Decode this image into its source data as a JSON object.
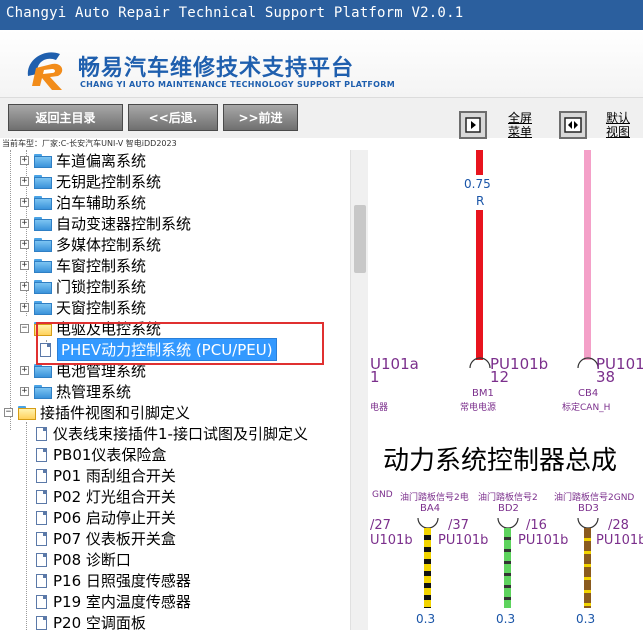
{
  "window": {
    "title": "Changyi Auto Repair Technical Support Platform V2.0.1"
  },
  "banner": {
    "brand_cn": "畅易汽车维修技术支持平台",
    "brand_en": "CHANG YI AUTO MAINTENANCE TECHNOLOGY SUPPORT PLATFORM"
  },
  "toolbar": {
    "home": "返回主目录",
    "back": "<<后退.",
    "forward": ">>前进",
    "fullscreen": "全屏\n菜单",
    "default_view": "默认\n视图"
  },
  "car_info": "当前车型：厂家:C-长安汽车UNI-V 智电iDD2023",
  "tree": {
    "items": [
      {
        "label": "车道偏离系统",
        "type": "folder"
      },
      {
        "label": "无钥匙控制系统",
        "type": "folder"
      },
      {
        "label": "泊车辅助系统",
        "type": "folder"
      },
      {
        "label": "自动变速器控制系统",
        "type": "folder"
      },
      {
        "label": "多媒体控制系统",
        "type": "folder"
      },
      {
        "label": "车窗控制系统",
        "type": "folder"
      },
      {
        "label": "门锁控制系统",
        "type": "folder"
      },
      {
        "label": "天窗控制系统",
        "type": "folder"
      },
      {
        "label": "电驱及电控系统",
        "type": "folder-open"
      },
      {
        "label": "PHEV动力控制系统 (PCU/PEU)",
        "type": "doc",
        "selected": true
      },
      {
        "label": "电池管理系统",
        "type": "folder"
      },
      {
        "label": "热管理系统",
        "type": "folder"
      },
      {
        "label": "接插件视图和引脚定义",
        "type": "folder-open"
      },
      {
        "label": "仪表线束接插件1-接口试图及引脚定义",
        "type": "doc"
      },
      {
        "label": "PB01仪表保险盒",
        "type": "doc"
      },
      {
        "label": "P01 雨刮组合开关",
        "type": "doc"
      },
      {
        "label": "P02 灯光组合开关",
        "type": "doc"
      },
      {
        "label": "P06 启动停止开关",
        "type": "doc"
      },
      {
        "label": "P07 仪表板开关盒",
        "type": "doc"
      },
      {
        "label": "P08 诊断口",
        "type": "doc"
      },
      {
        "label": "P16 日照强度传感器",
        "type": "doc"
      },
      {
        "label": "P19 室内温度传感器",
        "type": "doc"
      },
      {
        "label": "P20 空调面板",
        "type": "doc"
      }
    ]
  },
  "diagram": {
    "wire_top_label": "0.75",
    "wire_top_color": "R",
    "conn_left": "U101a",
    "conn_left_pin": "1",
    "conn_mid": "PU101b",
    "conn_mid_pin": "12",
    "conn_right": "PU101",
    "conn_right_pin": "38",
    "label_bm1": "BM1",
    "label_bm1_desc": "常电电源",
    "label_cb4": "CB4",
    "label_cb4_desc": "标定CAN_H",
    "label_left_desc": "电器",
    "title": "动力系统控制器总成",
    "bottom_labels": [
      "GND",
      "油门踏板信号2电",
      "油门踏板信号2",
      "油门踏板信号2GND"
    ],
    "bottom_codes": [
      "BA4",
      "BD2",
      "BD3"
    ],
    "bottom_pins": [
      "/27",
      "/37",
      "/16",
      "/28"
    ],
    "bottom_conns": [
      "U101b",
      "PU101b",
      "PU101b",
      "PU101b"
    ],
    "bottom_sizes": [
      "0.3",
      "0.3",
      "0.3"
    ],
    "colors": {
      "red": "#e8141e",
      "pink": "#f4a0c8",
      "yellow": "#f2d400",
      "green": "#5dd35d",
      "brown": "#8a5a1e"
    }
  }
}
